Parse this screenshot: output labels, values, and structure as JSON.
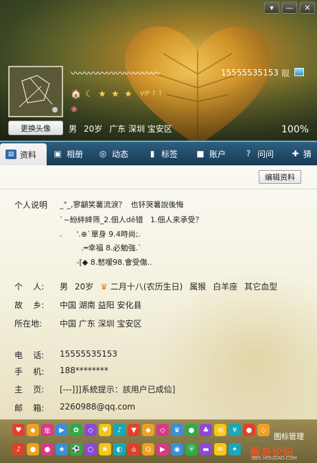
{
  "window": {
    "controls": [
      "▾",
      "—",
      "✕"
    ]
  },
  "profile": {
    "nickname": "〰〰〰〰〰〰〰〰〰〰",
    "qq_number": "15555535153",
    "cool_icon": "靓",
    "vip": "VIP 7 ↑",
    "gender": "男",
    "age": "20岁",
    "location": "广东 深圳 宝安区",
    "completeness": "100%",
    "change_avatar_label": "更换头像"
  },
  "tabs": [
    {
      "label": "资料",
      "icon": "profile-card-icon"
    },
    {
      "label": "相册",
      "icon": "photo-album-icon"
    },
    {
      "label": "动态",
      "icon": "news-feed-icon"
    },
    {
      "label": "标签",
      "icon": "bookmark-icon"
    },
    {
      "label": "账户",
      "icon": "wallet-icon"
    },
    {
      "label": "问问",
      "icon": "question-icon"
    },
    {
      "label": "猜",
      "icon": "puzzle-icon"
    }
  ],
  "info": {
    "edit_label": "编辑资料",
    "signature_label": "个人说明",
    "signature_lines": [
      "_\"_,寥龥笑薯流淚？  也钚哭薯說後悔",
      "`~紛絆緈筛_2.佃人dě错   1.佃人来承受？",
      ".      '.⊕`單身 9.4時尚;.",
      "         .═幸福 8.必勉強.`",
      "       -[◆ 8.慭嗳98.會受傷.."
    ],
    "person_label": "个    人:",
    "person_gender": "男",
    "person_age": "20岁",
    "birthday": "二月十八(农历生日)",
    "zodiac": "属猴",
    "constellation": "白羊座",
    "blood": "其它血型",
    "hometown_label": "故    乡:",
    "hometown": "中国 湖南 益阳 安化县",
    "location_label": "所在地:",
    "location": "中国 广东 深圳 宝安区",
    "phone_label": "电    话:",
    "phone": "15555535153",
    "mobile_label": "手    机:",
    "mobile": "188********",
    "homepage_label": "主    页:",
    "homepage": "[---]]]系統提示：該用户已成佡]",
    "email_label": "邮    箱:",
    "email": "2260988@qq.com"
  },
  "bottom": {
    "icon_manager_label": "图标管理",
    "watermark": "猴岛论坛",
    "watermark_url": "BBS.HOUDAO.COM",
    "icons_row1": [
      "heart-icon",
      "gem-icon",
      "year-icon",
      "game-icon",
      "gift-icon",
      "diamond-icon",
      "heart-icon",
      "music-icon",
      "tie-icon",
      "gem-icon",
      "diamond-icon",
      "crown-icon",
      "pet-icon",
      "tree-icon",
      "book-icon",
      "shop-icon",
      "pet-icon",
      "diamond-icon"
    ],
    "icons_row2": [
      "music-icon",
      "pet-icon",
      "pet-icon",
      "star-icon",
      "sport-icon",
      "ring-icon",
      "flower-icon",
      "egg-icon",
      "house-icon",
      "qzone-icon",
      "game-icon",
      "candy-icon",
      "shield-icon",
      "car-icon",
      "email-icon",
      "crystal-icon"
    ]
  },
  "colors": {
    "tab_bar": "#1f4a68",
    "accent_blue": "#2f6aa8",
    "bottom_bar": "#857540"
  }
}
